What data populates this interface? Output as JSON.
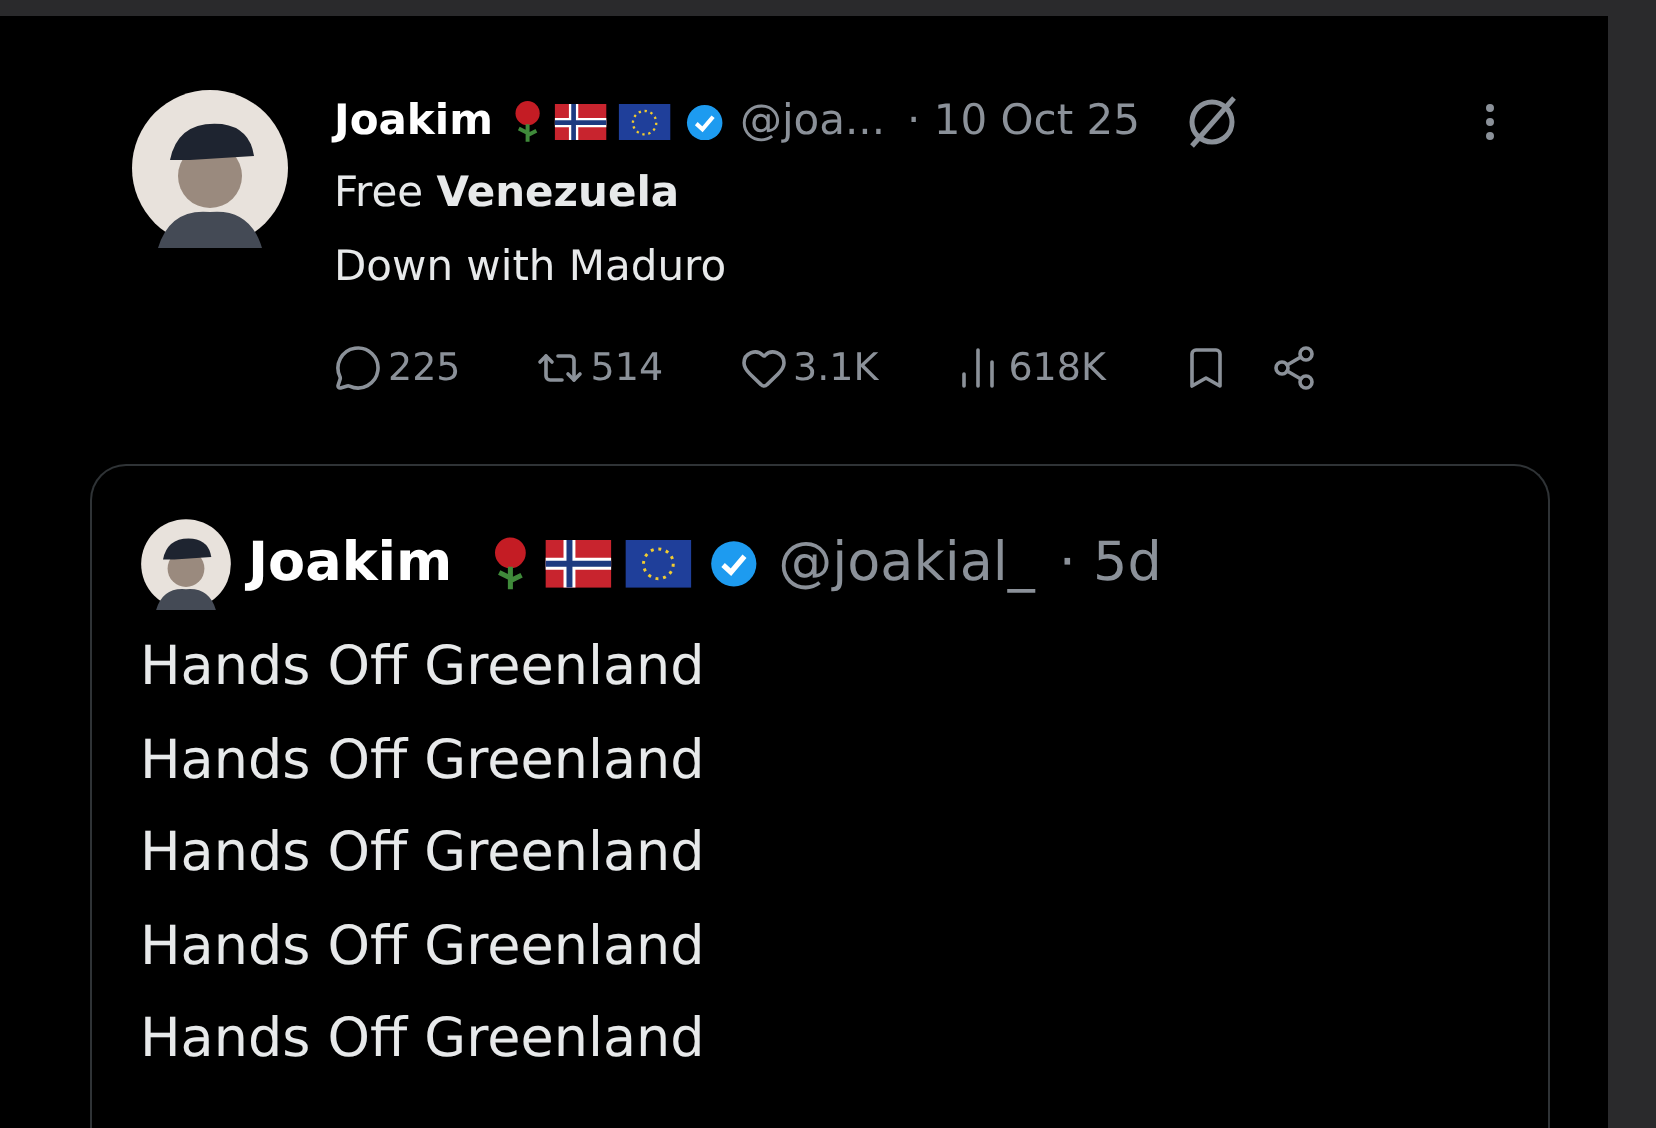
{
  "tweet": {
    "name": "Joakim",
    "verified": true,
    "handle": "@joa...",
    "time": "· 10 Oct 25",
    "lines": [
      "Free **Venezuela**",
      "Down with Maduro"
    ],
    "stats": [
      {
        "kind": "reply",
        "count": "225"
      },
      {
        "kind": "repost",
        "count": "514"
      },
      {
        "kind": "like",
        "count": "3.1K"
      },
      {
        "kind": "views",
        "count": "618K"
      },
      {
        "kind": "bookmark"
      },
      {
        "kind": "share"
      }
    ]
  },
  "quote": {
    "name": "Joakim",
    "verified": true,
    "handle": "@joakial_",
    "time": "· 5d",
    "lines": [
      "Hands Off Greenland",
      "Hands Off Greenland",
      "Hands Off Greenland",
      "Hands Off Greenland",
      "Hands Off Greenland"
    ]
  }
}
